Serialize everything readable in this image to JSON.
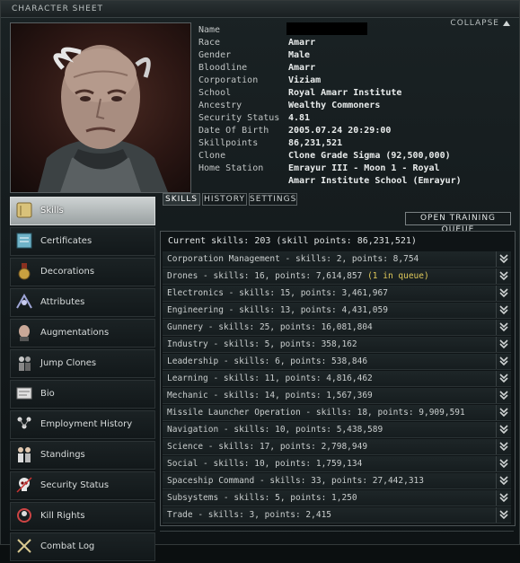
{
  "window": {
    "title": "CHARACTER SHEET",
    "collapse_label": "COLLAPSE"
  },
  "character": {
    "fields": [
      {
        "label": "Name",
        "value": ""
      },
      {
        "label": "Race",
        "value": "Amarr"
      },
      {
        "label": "Gender",
        "value": "Male"
      },
      {
        "label": "Bloodline",
        "value": "Amarr"
      },
      {
        "label": "Corporation",
        "value": "Viziam"
      },
      {
        "label": "School",
        "value": "Royal Amarr Institute"
      },
      {
        "label": "Ancestry",
        "value": "Wealthy Commoners"
      },
      {
        "label": "Security Status",
        "value": "4.81"
      },
      {
        "label": "Date Of Birth",
        "value": "2005.07.24  20:29:00"
      },
      {
        "label": "Skillpoints",
        "value": "86,231,521"
      },
      {
        "label": "Clone",
        "value": "Clone Grade Sigma (92,500,000)"
      },
      {
        "label": "Home Station",
        "value": "Emrayur III - Moon 1 - Royal"
      },
      {
        "label": "",
        "value": "Amarr Institute School (Emrayur)"
      }
    ]
  },
  "sidebar": {
    "items": [
      {
        "label": "Skills",
        "icon": "book-icon",
        "active": true
      },
      {
        "label": "Certificates",
        "icon": "certificate-icon"
      },
      {
        "label": "Decorations",
        "icon": "medal-icon"
      },
      {
        "label": "Attributes",
        "icon": "attributes-icon"
      },
      {
        "label": "Augmentations",
        "icon": "implant-head-icon"
      },
      {
        "label": "Jump Clones",
        "icon": "clone-icon"
      },
      {
        "label": "Bio",
        "icon": "bio-document-icon"
      },
      {
        "label": "Employment History",
        "icon": "employment-icon"
      },
      {
        "label": "Standings",
        "icon": "standings-icon"
      },
      {
        "label": "Security Status",
        "icon": "skull-icon"
      },
      {
        "label": "Kill Rights",
        "icon": "kill-rights-icon"
      },
      {
        "label": "Combat Log",
        "icon": "crossed-swords-icon"
      }
    ]
  },
  "tabs": [
    {
      "label": "SKILLS",
      "active": true
    },
    {
      "label": "HISTORY"
    },
    {
      "label": "SETTINGS"
    }
  ],
  "open_training_queue_label": "OPEN TRAINING QUEUE",
  "skills": {
    "summary": "Current skills: 203 (skill points: 86,231,521)",
    "groups": [
      {
        "text": "Corporation Management - skills: 2, points: 8,754",
        "queue": ""
      },
      {
        "text": "Drones - skills: 16, points: 7,614,857 ",
        "queue": "(1 in queue)"
      },
      {
        "text": "Electronics - skills: 15, points: 3,461,967",
        "queue": ""
      },
      {
        "text": "Engineering - skills: 13, points: 4,431,059",
        "queue": ""
      },
      {
        "text": "Gunnery - skills: 25, points: 16,081,804",
        "queue": ""
      },
      {
        "text": "Industry - skills: 5, points: 358,162",
        "queue": ""
      },
      {
        "text": "Leadership - skills: 6, points: 538,846",
        "queue": ""
      },
      {
        "text": "Learning - skills: 11, points: 4,816,462",
        "queue": ""
      },
      {
        "text": "Mechanic - skills: 14, points: 1,567,369",
        "queue": ""
      },
      {
        "text": "Missile Launcher Operation - skills: 18, points: 9,909,591",
        "queue": ""
      },
      {
        "text": "Navigation - skills: 10, points: 5,438,589",
        "queue": ""
      },
      {
        "text": "Science - skills: 17, points: 2,798,949",
        "queue": ""
      },
      {
        "text": "Social - skills: 10, points: 1,759,134",
        "queue": ""
      },
      {
        "text": "Spaceship Command - skills: 33, points: 27,442,313",
        "queue": ""
      },
      {
        "text": "Subsystems - skills: 5, points: 1,250",
        "queue": ""
      },
      {
        "text": "Trade - skills: 3, points: 2,415",
        "queue": ""
      }
    ]
  }
}
